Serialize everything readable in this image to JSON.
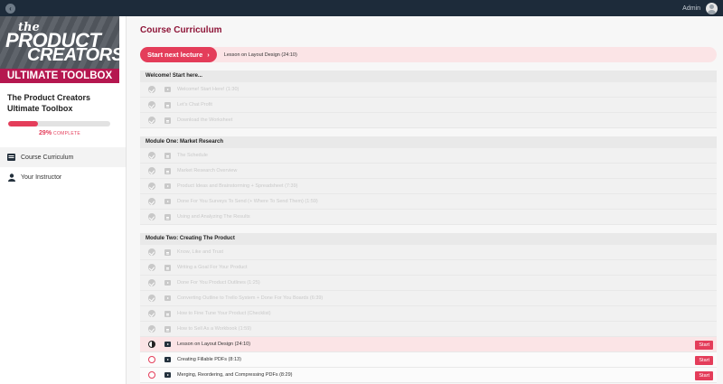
{
  "topbar": {
    "user_name": "Admin"
  },
  "sidebar": {
    "logo": {
      "line1": "the",
      "line2": "PRODUCT",
      "line3": "CREATORS",
      "band": "ULTIMATE TOOLBOX"
    },
    "course_title": "The Product Creators Ultimate Toolbox",
    "progress": {
      "percent": 29,
      "label": "29%",
      "suffix": "COMPLETE"
    },
    "nav": [
      {
        "label": "Course Curriculum",
        "icon": "list-icon",
        "active": true
      },
      {
        "label": "Your Instructor",
        "icon": "user-icon",
        "active": false
      }
    ]
  },
  "main": {
    "title": "Course Curriculum",
    "next_button": "Start next lecture",
    "next_lecture": "Lesson on Layout Design (24:10)",
    "start_label": "Start",
    "modules": [
      {
        "title": "Welcome! Start here...",
        "lectures": [
          {
            "title": "Welcome! Start Here! (1:30)",
            "type": "video",
            "status": "done"
          },
          {
            "title": "Let's Chat Profit",
            "type": "doc",
            "status": "done"
          },
          {
            "title": "Download the Worksheet",
            "type": "doc",
            "status": "done"
          }
        ]
      },
      {
        "title": "Module One: Market Research",
        "lectures": [
          {
            "title": "The Schedule",
            "type": "doc",
            "status": "done"
          },
          {
            "title": "Market Research Overview",
            "type": "doc",
            "status": "done"
          },
          {
            "title": "Product Ideas and Brainstorming + Spreadsheet (7:39)",
            "type": "video",
            "status": "done"
          },
          {
            "title": "Done For You Surveys To Send (+ Where To Send Them) (1:59)",
            "type": "video",
            "status": "done"
          },
          {
            "title": "Using and Analyzing The Results",
            "type": "doc",
            "status": "done"
          }
        ]
      },
      {
        "title": "Module Two: Creating The Product",
        "lectures": [
          {
            "title": "Know, Like and Trust",
            "type": "doc",
            "status": "done"
          },
          {
            "title": "Writing a Goal For Your Product",
            "type": "doc",
            "status": "done"
          },
          {
            "title": "Done For You Product Outlines (1:25)",
            "type": "video",
            "status": "done"
          },
          {
            "title": "Converting Outline to Trello System + Done For You Boards (6:39)",
            "type": "video",
            "status": "done"
          },
          {
            "title": "How to Fine Tune Your Product (Checklist)",
            "type": "doc",
            "status": "done"
          },
          {
            "title": "How to Sell As a Workbook (1:59)",
            "type": "doc",
            "status": "done"
          },
          {
            "title": "Lesson on Layout Design (24:10)",
            "type": "video",
            "status": "current"
          },
          {
            "title": "Creating Fillable PDFs (8:13)",
            "type": "video",
            "status": "open"
          },
          {
            "title": "Merging, Reordering, and Compressing PDFs (8:29)",
            "type": "video",
            "status": "open"
          }
        ]
      }
    ]
  }
}
